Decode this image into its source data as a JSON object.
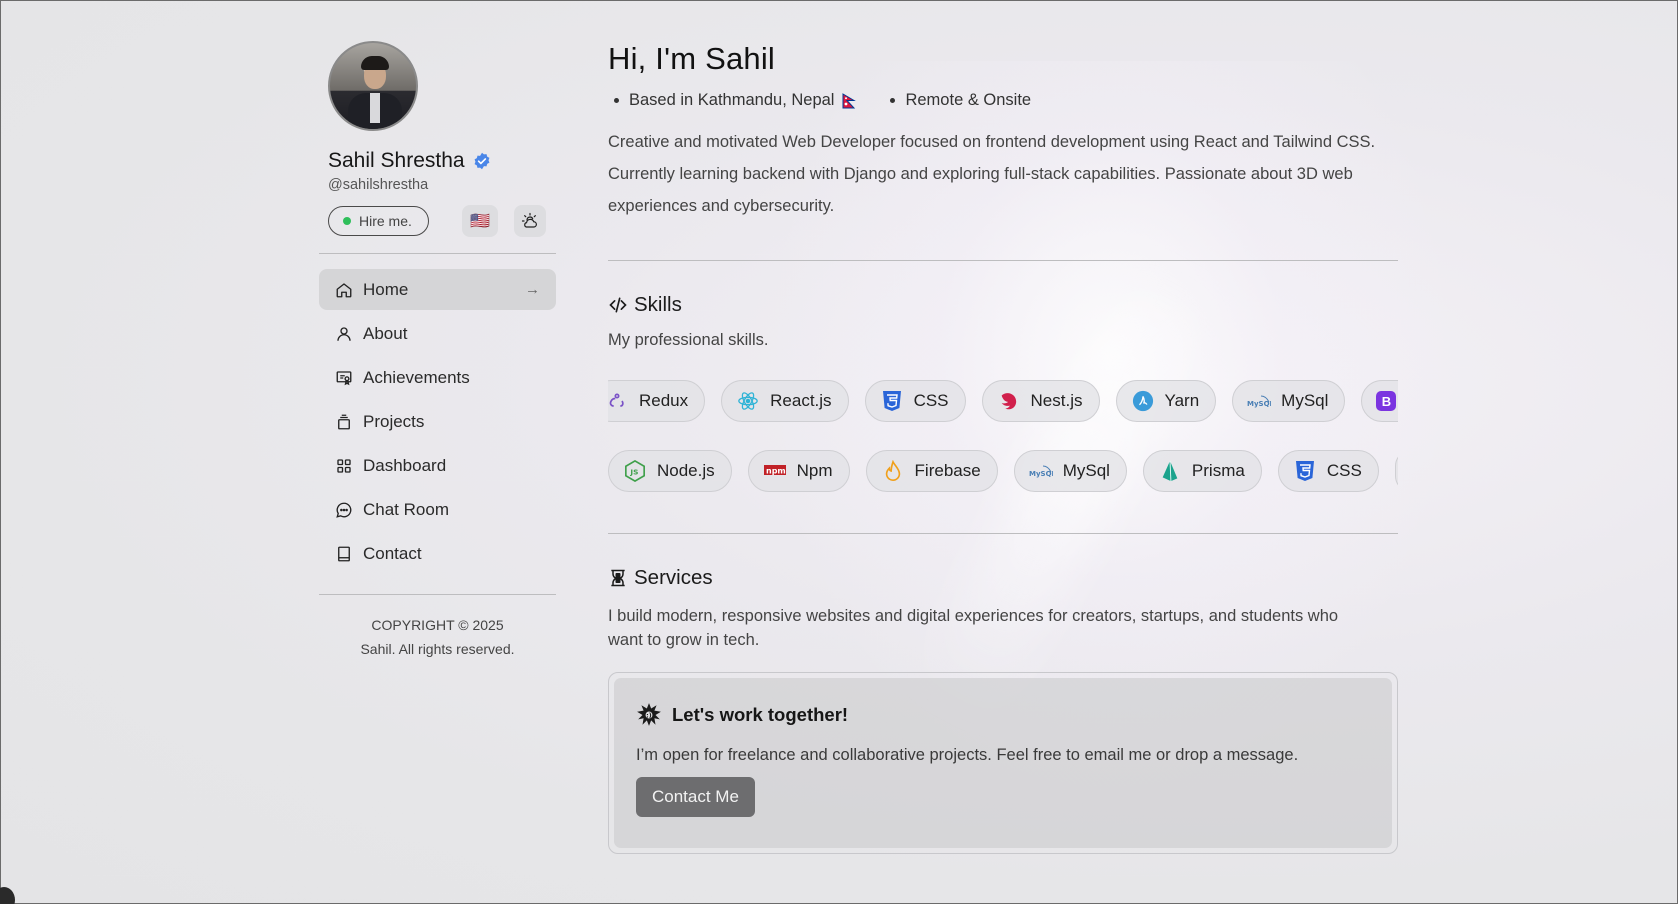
{
  "profile": {
    "name": "Sahil Shrestha",
    "handle": "@sahilshrestha",
    "hire_label": "Hire me.",
    "flag_emoji": "🇺🇸",
    "theme_icon": "cloud-sun-icon"
  },
  "nav": {
    "items": [
      {
        "label": "Home",
        "icon": "home-icon",
        "active": true
      },
      {
        "label": "About",
        "icon": "user-icon"
      },
      {
        "label": "Achievements",
        "icon": "certificate-icon"
      },
      {
        "label": "Projects",
        "icon": "layers-icon"
      },
      {
        "label": "Dashboard",
        "icon": "grid-icon"
      },
      {
        "label": "Chat Room",
        "icon": "chat-icon"
      },
      {
        "label": "Contact",
        "icon": "book-icon"
      }
    ],
    "active_arrow": "→"
  },
  "footer": {
    "line1": "COPYRIGHT © 2025",
    "line2": "Sahil. All rights reserved."
  },
  "hero": {
    "greeting": "Hi, I'm Sahil",
    "location": "Based in Kathmandu, Nepal",
    "work_mode": "Remote & Onsite",
    "bio": "Creative and motivated Web Developer focused on frontend development using React and Tailwind CSS. Currently learning backend with Django and exploring full-stack capabilities. Passionate about 3D web experiences and cybersecurity."
  },
  "skills": {
    "title": "Skills",
    "subtitle": "My professional skills.",
    "row1": [
      "Redux",
      "React.js",
      "CSS",
      "Nest.js",
      "Yarn",
      "MySql",
      "B"
    ],
    "row2": [
      "Node.js",
      "Npm",
      "Firebase",
      "MySql",
      "Prisma",
      "CSS",
      ""
    ]
  },
  "services": {
    "title": "Services",
    "text": "I build modern, responsive websites and digital experiences for creators, startups, and students who want to grow in tech.",
    "card_title": "Let's work together!",
    "card_text": "I’m open for freelance and collaborative projects. Feel free to email me or drop a message.",
    "button_label": "Contact Me"
  },
  "colors": {
    "accent_blue": "#3b82f6",
    "online_green": "#2fbf5b",
    "button_gray": "#6d6d6f"
  }
}
